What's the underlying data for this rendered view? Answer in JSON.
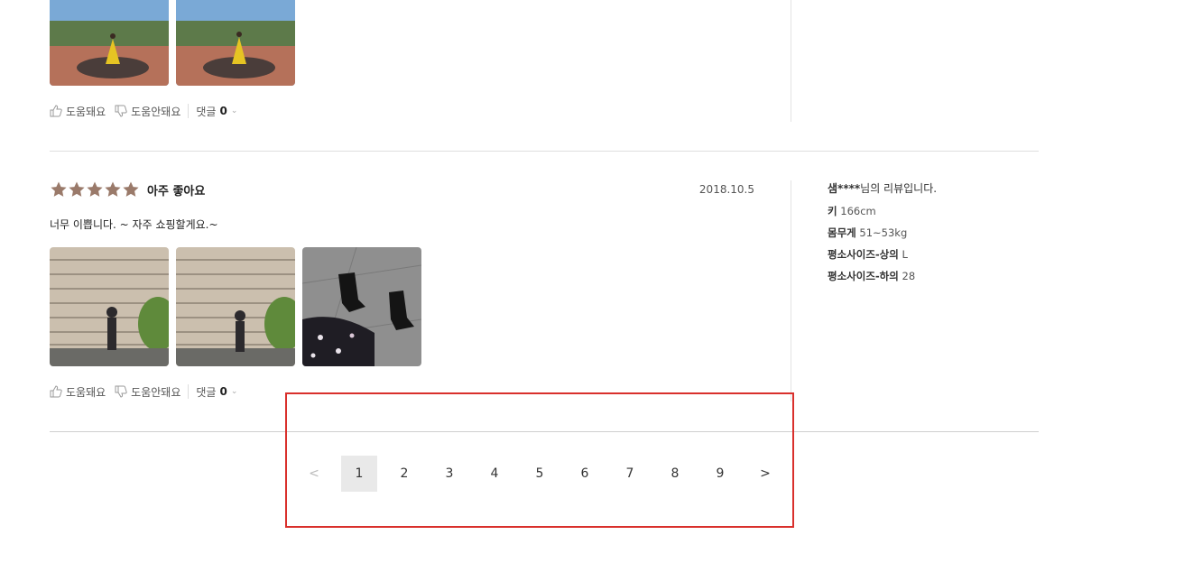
{
  "review_prev": {
    "helpful_label": "도움돼요",
    "not_helpful_label": "도움안돼요",
    "comment_label": "댓글",
    "comment_count": "0"
  },
  "review": {
    "rating": 5,
    "rating_label": "아주 좋아요",
    "date": "2018.10.5",
    "body": "너무 이쁩니다. ~ 자주 쇼핑할게요.~",
    "helpful_label": "도움돼요",
    "not_helpful_label": "도움안돼요",
    "comment_label": "댓글",
    "comment_count": "0",
    "reviewer": {
      "name": "샘****",
      "suffix": "님의 리뷰입니다.",
      "attributes": [
        {
          "label": "키",
          "value": "166cm"
        },
        {
          "label": "몸무게",
          "value": "51~53kg"
        },
        {
          "label": "평소사이즈-상의",
          "value": "L"
        },
        {
          "label": "평소사이즈-하의",
          "value": "28"
        }
      ]
    }
  },
  "pagination": {
    "prev": "<",
    "pages": [
      "1",
      "2",
      "3",
      "4",
      "5",
      "6",
      "7",
      "8",
      "9"
    ],
    "current": "1",
    "next": ">"
  },
  "colors": {
    "star": "#9a7a6a",
    "highlight": "#d9302c",
    "active_page_bg": "#e9e9e9"
  }
}
